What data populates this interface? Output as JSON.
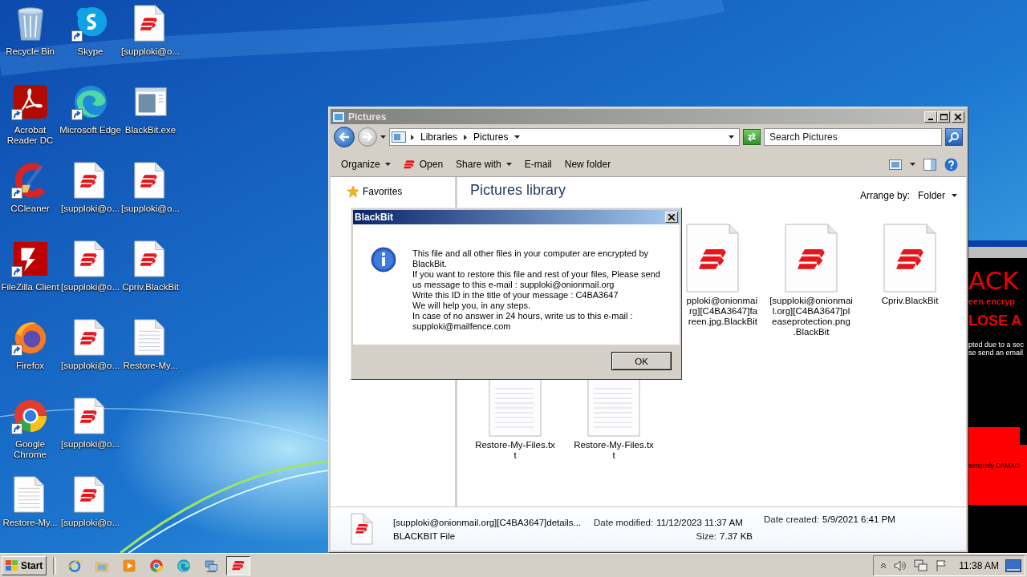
{
  "desktop": {
    "columns": [
      [
        {
          "label": "Recycle Bin",
          "kind": "recycle",
          "shortcut": false
        },
        {
          "label": "Acrobat\nReader DC",
          "kind": "acrobat",
          "shortcut": true
        },
        {
          "label": "CCleaner",
          "kind": "ccleaner",
          "shortcut": true
        },
        {
          "label": "FileZilla Client",
          "kind": "filezilla",
          "shortcut": true
        },
        {
          "label": "Firefox",
          "kind": "firefox",
          "shortcut": true
        },
        {
          "label": "Google\nChrome",
          "kind": "chrome",
          "shortcut": true
        },
        {
          "label": "Restore-My...",
          "kind": "text",
          "shortcut": false
        }
      ],
      [
        {
          "label": "Skype",
          "kind": "skype",
          "shortcut": true
        },
        {
          "label": "Microsoft Edge",
          "kind": "edge",
          "shortcut": true
        },
        {
          "label": "[supploki@o...",
          "kind": "blackbit",
          "shortcut": false
        },
        {
          "label": "[supploki@o...",
          "kind": "blackbit",
          "shortcut": false
        },
        {
          "label": "[supploki@o...",
          "kind": "blackbit",
          "shortcut": false
        },
        {
          "label": "[supploki@o...",
          "kind": "blackbit",
          "shortcut": false
        },
        {
          "label": "[supploki@o...",
          "kind": "blackbit",
          "shortcut": false
        }
      ],
      [
        {
          "label": "[supploki@o...",
          "kind": "blackbit",
          "shortcut": false
        },
        {
          "label": "BlackBit.exe",
          "kind": "exe",
          "shortcut": false
        },
        {
          "label": "[supploki@o...",
          "kind": "blackbit",
          "shortcut": false
        },
        {
          "label": "Cpriv.BlackBit",
          "kind": "blackbit",
          "shortcut": false
        },
        {
          "label": "Restore-My...",
          "kind": "text",
          "shortcut": false
        }
      ]
    ]
  },
  "background_window": {
    "lines": [
      {
        "kind": "title",
        "text": "ACK"
      },
      {
        "kind": "subtitle",
        "text": "een encryp"
      },
      {
        "kind": "warning",
        "text": "LOSE A"
      },
      {
        "kind": "body",
        "text": "pted due to a sec"
      },
      {
        "kind": "body",
        "text": "se send an email"
      },
      {
        "kind": "band",
        "text": "seriously DAMAG"
      }
    ]
  },
  "explorer": {
    "title": "Pictures",
    "breadcrumbs": [
      "Libraries",
      "Pictures"
    ],
    "search": {
      "placeholder": "Search Pictures"
    },
    "commands": [
      {
        "label": "Organize",
        "kind": "menu"
      },
      {
        "label": "Open",
        "kind": "open"
      },
      {
        "label": "Share with",
        "kind": "menu"
      },
      {
        "label": "E-mail",
        "kind": "plain"
      },
      {
        "label": "New folder",
        "kind": "plain"
      }
    ],
    "nav": [
      {
        "label": "Favorites",
        "kind": "favorites"
      }
    ],
    "library_title": "Pictures library",
    "arrange": {
      "label": "Arrange by:",
      "value": "Folder"
    },
    "files": [
      {
        "label": "pploki@onionmai\nrg][C4BA3647]fa\nreen.jpg.BlackBit",
        "kind": "blackbit",
        "cut_left": true
      },
      {
        "label": "[supploki@onionmai\nl.org][C4BA3647]pl\neaseprotection.png\n.BlackBit",
        "kind": "blackbit",
        "cut_left": false
      },
      {
        "label": "Cpriv.BlackBit",
        "kind": "blackbit",
        "cut_left": false
      },
      {
        "label": "Restore-My-Files.tx\nt",
        "kind": "text",
        "cut_left": false
      },
      {
        "label": "Restore-My-Files.tx\nt",
        "kind": "text",
        "cut_left": false
      }
    ],
    "details": {
      "name": "[supploki@onionmail.org][C4BA3647]details...",
      "type": "BLACKBIT File",
      "modified_label": "Date modified:",
      "modified": "11/12/2023 11:37 AM",
      "size_label": "Size:",
      "size": "7.37 KB",
      "created_label": "Date created:",
      "created": "5/9/2021 6:41 PM"
    }
  },
  "dialog": {
    "title": "BlackBit",
    "message": "This file and all other files in your computer are encrypted by\nBlackBit.\nIf you want to restore this file and rest of your files, Please send\nus message to this e-mail : supploki@onionmail.org\nWrite this ID in the title of your message : C4BA3647\nWe will help you, in any steps.\nIn case of no answer in 24 hours, write us to this e-mail :\nsupploki@mailfence.com",
    "button": "OK"
  },
  "taskbar": {
    "start": "Start",
    "apps": [
      {
        "kind": "ie",
        "selected": false
      },
      {
        "kind": "folder",
        "selected": false
      },
      {
        "kind": "media",
        "selected": false
      },
      {
        "kind": "chrome",
        "selected": false
      },
      {
        "kind": "edge",
        "selected": false
      },
      {
        "kind": "network",
        "selected": false
      },
      {
        "kind": "blackbit",
        "selected": true
      }
    ],
    "time": "11:38 AM"
  }
}
